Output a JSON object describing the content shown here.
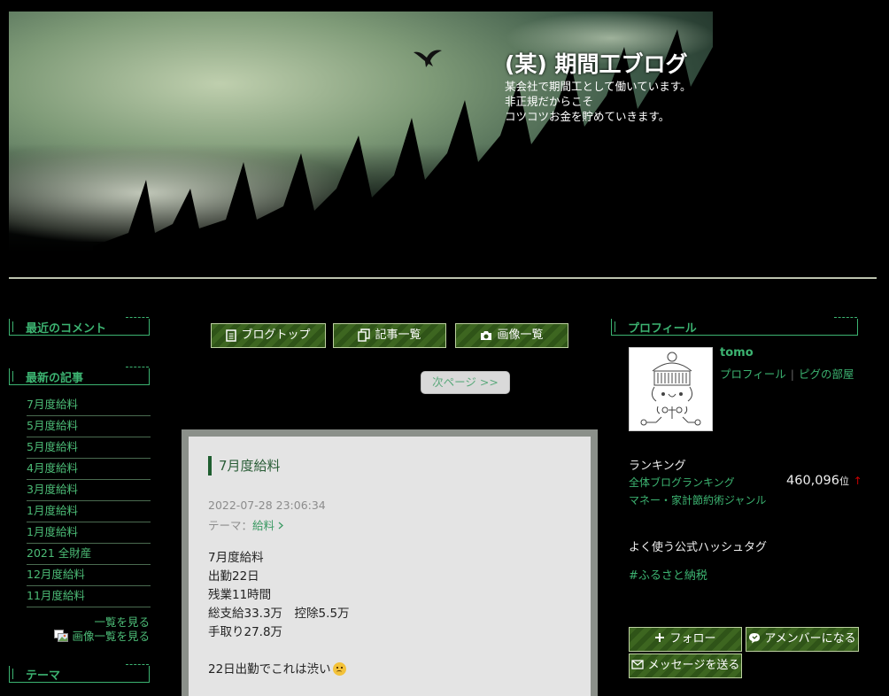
{
  "header": {
    "title": "(某) 期間工ブログ",
    "description": [
      "某会社で期間工として働いています。",
      "非正規だからこそ",
      "コツコツお金を貯めていきます。"
    ]
  },
  "left_sidebar": {
    "recent_comments_heading": "最近のコメント",
    "recent_articles_heading": "最新の記事",
    "recent_articles": [
      "7月度給料",
      "5月度給料",
      "5月度給料",
      "4月度給料",
      "3月度給料",
      "1月度給料",
      "1月度給料",
      "2021 全財産",
      "12月度給料",
      "11月度給料"
    ],
    "see_list_label": "一覧を見る",
    "see_images_label": "画像一覧を見る",
    "theme_heading": "テーマ"
  },
  "nav": {
    "blog_top": "ブログトップ",
    "article_list": "記事一覧",
    "image_list": "画像一覧",
    "next_page": "次ページ >>"
  },
  "article": {
    "title": "7月度給料",
    "date": "2022-07-28 23:06:34",
    "theme_prefix": "テーマ：",
    "theme": "給料",
    "body": [
      "7月度給料",
      "出勤22日",
      "残業11時間",
      "総支給33.3万　控除5.5万",
      "手取り27.8万",
      "",
      "22日出勤でこれは渋い"
    ]
  },
  "right_sidebar": {
    "profile_heading": "プロフィール",
    "user_name": "tomo",
    "profile_link": "プロフィール",
    "pig_link": "ピグの部屋",
    "ranking_heading": "ランキング",
    "ranking_overall": "全体ブログランキング",
    "ranking_genre": "マネー・家計節約術ジャンル",
    "ranking_value": "460,096",
    "ranking_unit": "位",
    "ranking_arrow": "↑",
    "hashtag_heading": "よく使う公式ハッシュタグ",
    "hashtag": "#ふるさと納税",
    "follow_button": "フォロー",
    "member_button": "アメンバーになる",
    "message_button": "メッセージを送る"
  },
  "colors": {
    "accent": "#3cb371",
    "button": "#3d6620",
    "article_bg": "#e4e4e4"
  }
}
